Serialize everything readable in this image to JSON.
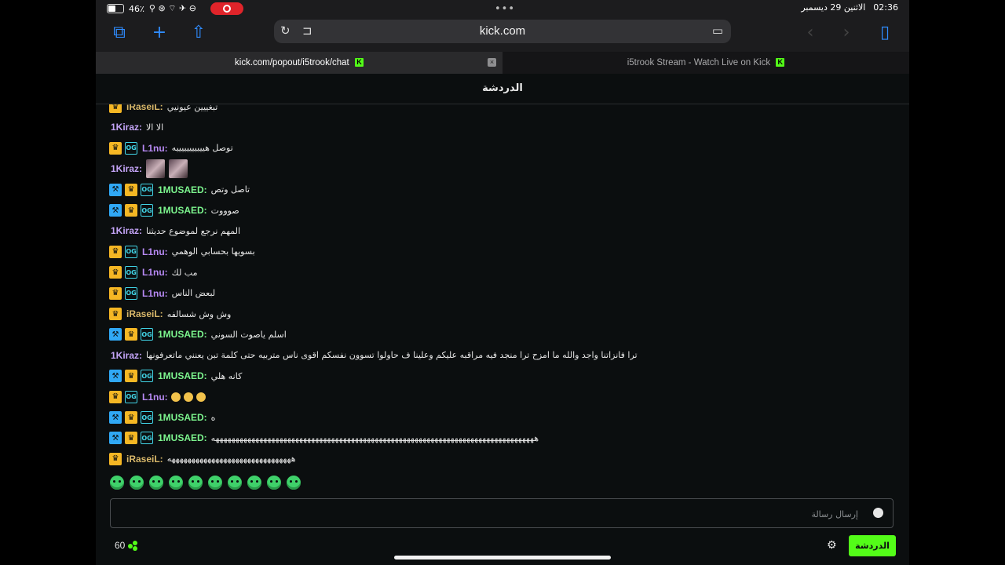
{
  "status_bar": {
    "battery": "46٪",
    "time": "02:36",
    "date": "الاثنين 29 ديسمبر"
  },
  "browser": {
    "url": "kick.com",
    "tabs": [
      {
        "title": "kick.com/popout/i5trook/chat",
        "active": true
      },
      {
        "title": "i5trook Stream - Watch Live on Kick",
        "active": false
      }
    ]
  },
  "chat": {
    "header": "الدردشة",
    "messages": [
      {
        "user": "iRaseiL:",
        "text": "تبغييين عيونيي",
        "badges": [
          "crown"
        ],
        "color": "gold"
      },
      {
        "user": "1Kiraz:",
        "text": "الا الا",
        "badges": [],
        "color": "pink"
      },
      {
        "user": "L1nu:",
        "text": "توصل هيييييييييييه",
        "badges": [
          "crown",
          "og"
        ],
        "color": "purple"
      },
      {
        "user": "1Kiraz:",
        "text": "",
        "badges": [],
        "color": "pink",
        "emotes": 2
      },
      {
        "user": "1MUSAED:",
        "text": "تاصل وتص",
        "badges": [
          "mod",
          "crown",
          "og"
        ],
        "color": "green"
      },
      {
        "user": "1MUSAED:",
        "text": "صوووت",
        "badges": [
          "mod",
          "crown",
          "og"
        ],
        "color": "green"
      },
      {
        "user": "1Kiraz:",
        "text": "المهم نرجع لموضوع حديثنا",
        "badges": [],
        "color": "pink"
      },
      {
        "user": "L1nu:",
        "text": "بسويها بحسابي الوهمي",
        "badges": [
          "crown",
          "og"
        ],
        "color": "purple"
      },
      {
        "user": "L1nu:",
        "text": "مب لك",
        "badges": [
          "crown",
          "og"
        ],
        "color": "purple"
      },
      {
        "user": "L1nu:",
        "text": "لبعض الناس",
        "badges": [
          "crown",
          "og"
        ],
        "color": "purple"
      },
      {
        "user": "iRaseiL:",
        "text": "وش وش شسالفه",
        "badges": [
          "crown"
        ],
        "color": "gold"
      },
      {
        "user": "1MUSAED:",
        "text": "اسلم ياصوت السوني",
        "badges": [
          "mod",
          "crown",
          "og"
        ],
        "color": "green"
      },
      {
        "user": "1Kiraz:",
        "text": "ترا فانزاتنا واجد والله ما امزح ترا منجد فيه مراقبه عليكم وعلينا ف حاولوا تسوون نفسكم اقوى ناس متربيه حتى كلمة تبن يعنني ماتعرفونها",
        "badges": [],
        "color": "pink"
      },
      {
        "user": "1MUSAED:",
        "text": "كانه هلي",
        "badges": [
          "mod",
          "crown",
          "og"
        ],
        "color": "green"
      },
      {
        "user": "L1nu:",
        "text": "",
        "badges": [
          "crown",
          "og"
        ],
        "color": "purple",
        "smileys": 3
      },
      {
        "user": "1MUSAED:",
        "text": "ه",
        "badges": [
          "mod",
          "crown",
          "og"
        ],
        "color": "green"
      },
      {
        "user": "1MUSAED:",
        "text": "هههههههههههههههههههههههههههههههههههههههههههههههههههههههههههههههههههههههههههههههههه",
        "badges": [
          "mod",
          "crown",
          "og"
        ],
        "color": "green"
      },
      {
        "user": "iRaseiL:",
        "text": "هههههههههههههههههههههههههههههههه",
        "badges": [
          "crown"
        ],
        "color": "gold"
      }
    ],
    "input_placeholder": "إرسال رسالة",
    "viewer_count": "60",
    "send_label": "الدردشة"
  }
}
